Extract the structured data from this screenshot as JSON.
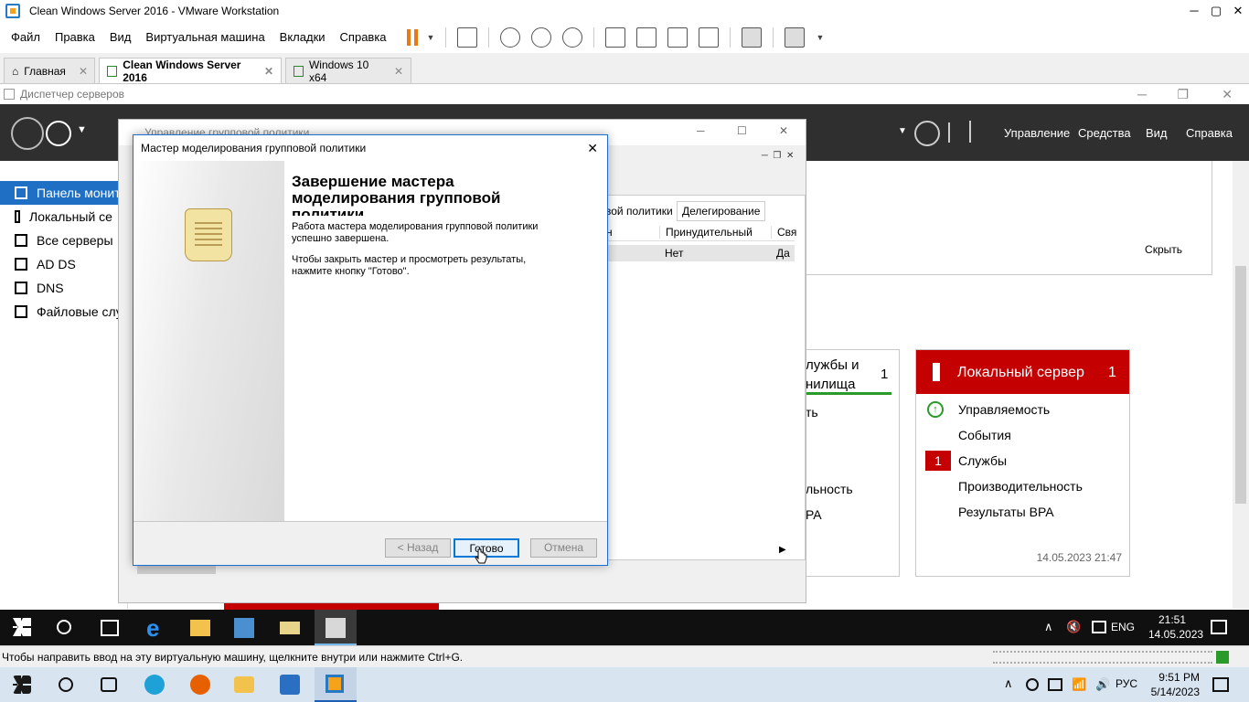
{
  "vmware": {
    "title": "Clean Windows Server 2016 - VMware Workstation",
    "menu": [
      "Файл",
      "Правка",
      "Вид",
      "Виртуальная машина",
      "Вкладки",
      "Справка"
    ],
    "tabs": [
      {
        "label": "Главная"
      },
      {
        "label": "Clean Windows Server 2016"
      },
      {
        "label": "Windows 10 x64"
      }
    ],
    "status": "Чтобы направить ввод на эту виртуальную машину, щелкните внутри или нажмите Ctrl+G."
  },
  "server_manager": {
    "title": "Диспетчер серверов",
    "menu": {
      "manage": "Управление",
      "tools": "Средства",
      "view": "Вид",
      "help": "Справка"
    },
    "sidebar": [
      "Панель монит",
      "Локальный се",
      "Все серверы",
      "AD DS",
      "DNS",
      "Файловые слу"
    ],
    "hide": "Скрыть",
    "tile_storage": {
      "title_line1": "лужбы и",
      "title_line2": "нилища",
      "count": "1",
      "rows": [
        "ть",
        "",
        "",
        "льность",
        "PA"
      ]
    },
    "tile_local": {
      "title": "Локальный сервер",
      "count": "1",
      "rows": [
        "Управляемость",
        "События",
        "Службы",
        "Производительность",
        "Результаты BPA"
      ],
      "services_badge": "1",
      "timestamp": "14.05.2023 21:47"
    }
  },
  "gpm": {
    "title": "Управление групповой политики",
    "tabs": [
      "вой политики",
      "Делегирование"
    ],
    "columns": [
      "н",
      "Принудительный",
      "Свя"
    ],
    "row": [
      "",
      "Нет",
      "Да"
    ]
  },
  "wizard": {
    "title": "Мастер моделирования групповой политики",
    "heading": "Завершение мастера моделирования групповой политики",
    "p1": "Работа мастера моделирования групповой политики успешно завершена.",
    "p2": "Чтобы закрыть мастер и просмотреть результаты, нажмите кнопку \"Готово\".",
    "back": "< Назад",
    "finish": "Готово",
    "cancel": "Отмена"
  },
  "guest_taskbar": {
    "lang": "ENG",
    "time": "21:51",
    "date": "14.05.2023"
  },
  "host_taskbar": {
    "lang": "РУС",
    "time": "9:51 PM",
    "date": "5/14/2023"
  },
  "colors": {
    "accent": "#1f6fc4",
    "alert": "#c50000",
    "dark": "#2f2f2f"
  }
}
